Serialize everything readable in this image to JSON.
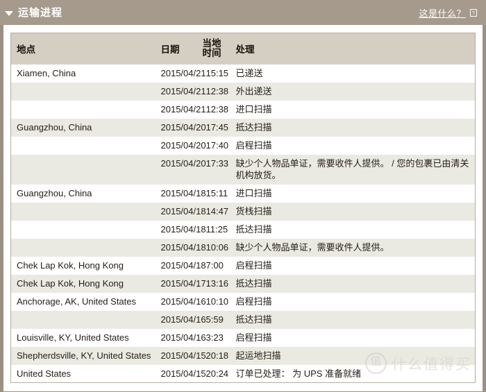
{
  "header": {
    "title": "运输进程",
    "collapse_icon": "triangle-down-icon",
    "help_link": "这是什么？",
    "help_icon": "?",
    "bar_color": "#a69a8c"
  },
  "table": {
    "columns": [
      {
        "key": "location",
        "label": "地点"
      },
      {
        "key": "date",
        "label": "日期"
      },
      {
        "key": "time",
        "label": "当地\n时间",
        "label_line1": "当地",
        "label_line2": "时间"
      },
      {
        "key": "activity",
        "label": "处理"
      }
    ],
    "header_bg": "#d5cec3",
    "row_alt_bg": "#eaeae3",
    "rows": [
      {
        "location": "Xiamen, China",
        "date": "2015/04/21",
        "time": "15:15",
        "activity": "已递送"
      },
      {
        "location": "",
        "date": "2015/04/21",
        "time": "12:38",
        "activity": "外出递送"
      },
      {
        "location": "",
        "date": "2015/04/21",
        "time": "12:38",
        "activity": "进口扫描"
      },
      {
        "location": "Guangzhou, China",
        "date": "2015/04/20",
        "time": "17:45",
        "activity": "抵达扫描"
      },
      {
        "location": "",
        "date": "2015/04/20",
        "time": "17:40",
        "activity": "启程扫描"
      },
      {
        "location": "",
        "date": "2015/04/20",
        "time": "17:33",
        "activity": "缺少个人物品单证，需要收件人提供。 / 您的包裹已由清关机构放货。"
      },
      {
        "location": "Guangzhou, China",
        "date": "2015/04/18",
        "time": "15:11",
        "activity": "进口扫描"
      },
      {
        "location": "",
        "date": "2015/04/18",
        "time": "14:47",
        "activity": "货栈扫描"
      },
      {
        "location": "",
        "date": "2015/04/18",
        "time": "11:25",
        "activity": "抵达扫描"
      },
      {
        "location": "",
        "date": "2015/04/18",
        "time": "10:06",
        "activity": "缺少个人物品单证，需要收件人提供。"
      },
      {
        "location": "Chek Lap Kok, Hong Kong",
        "date": "2015/04/18",
        "time": "7:00",
        "activity": "启程扫描"
      },
      {
        "location": "Chek Lap Kok, Hong Kong",
        "date": "2015/04/17",
        "time": "13:16",
        "activity": "抵达扫描"
      },
      {
        "location": "Anchorage, AK, United States",
        "date": "2015/04/16",
        "time": "10:10",
        "activity": "启程扫描"
      },
      {
        "location": "",
        "date": "2015/04/16",
        "time": "5:59",
        "activity": "抵达扫描"
      },
      {
        "location": "Louisville, KY, United States",
        "date": "2015/04/16",
        "time": "3:23",
        "activity": "启程扫描"
      },
      {
        "location": "Shepherdsville, KY, United States",
        "date": "2015/04/15",
        "time": "20:18",
        "activity": "起运地扫描"
      },
      {
        "location": "United States",
        "date": "2015/04/15",
        "time": "20:24",
        "activity": "订单已处理： 为 UPS 准备就绪"
      }
    ]
  },
  "watermark": {
    "badge": "值",
    "text": "什么值得买"
  }
}
